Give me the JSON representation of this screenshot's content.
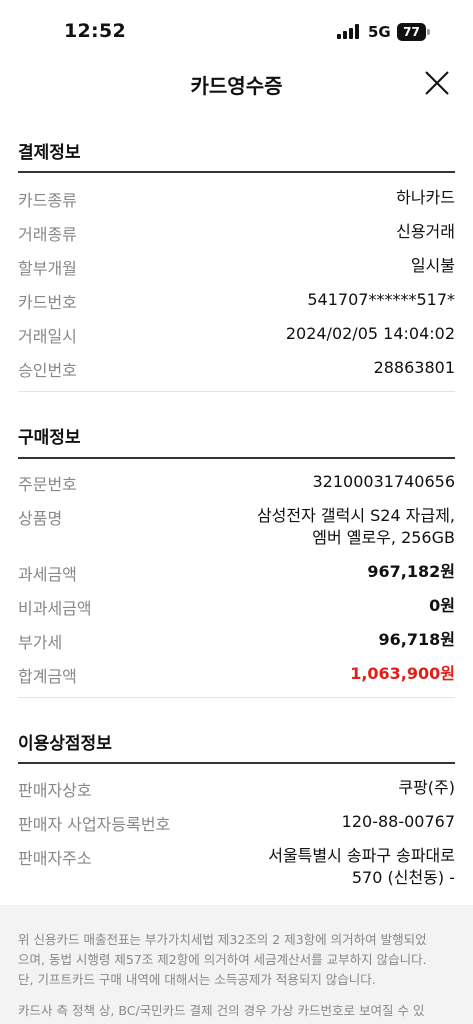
{
  "status_bar": {
    "time": "12:52",
    "network": "5G",
    "battery": "77"
  },
  "header": {
    "title": "카드영수증"
  },
  "payment_info": {
    "title": "결제정보",
    "rows": [
      {
        "label": "카드종류",
        "value": "하나카드"
      },
      {
        "label": "거래종류",
        "value": "신용거래"
      },
      {
        "label": "할부개월",
        "value": "일시불"
      },
      {
        "label": "카드번호",
        "value": "541707******517*"
      },
      {
        "label": "거래일시",
        "value": "2024/02/05 14:04:02"
      },
      {
        "label": "승인번호",
        "value": "28863801"
      }
    ]
  },
  "purchase_info": {
    "title": "구매정보",
    "rows": [
      {
        "label": "주문번호",
        "value": "32100031740656"
      },
      {
        "label": "상품명",
        "value_line1": "삼성전자 갤럭시 S24 자급제,",
        "value_line2": "엠버 옐로우, 256GB"
      },
      {
        "label": "과세금액",
        "value": "967,182원"
      },
      {
        "label": "비과세금액",
        "value": "0원"
      },
      {
        "label": "부가세",
        "value": "96,718원"
      },
      {
        "label": "합계금액",
        "value": "1,063,900원"
      }
    ]
  },
  "merchant_info": {
    "title": "이용상점정보",
    "rows": [
      {
        "label": "판매자상호",
        "value": "쿠팡(주)"
      },
      {
        "label": "판매자 사업자등록번호",
        "value": "120-88-00767"
      },
      {
        "label": "판매자주소",
        "value_line1": "서울특별시 송파구 송파대로",
        "value_line2": "570 (신천동) -"
      }
    ]
  },
  "notice": {
    "line1": "위 신용카드 매출전표는 부가가치세법 제32조의 2 제3항에 의거하여 발행되었",
    "line2": "으며, 동법 시행령 제57조 제2항에 의거하여 세금계산서를 교부하지 않습니다.",
    "line3": "단, 기프트카드 구매 내역에 대해서는 소득공제가 적용되지 않습니다.",
    "line4": "카드사 측 정책 상, BC/국민카드 결제 건의 경우 가상 카드번호로 보여질 수 있"
  },
  "colors": {
    "total_amount": "#e0201b",
    "label": "#888888",
    "notice_bg": "#f3f3f3"
  }
}
